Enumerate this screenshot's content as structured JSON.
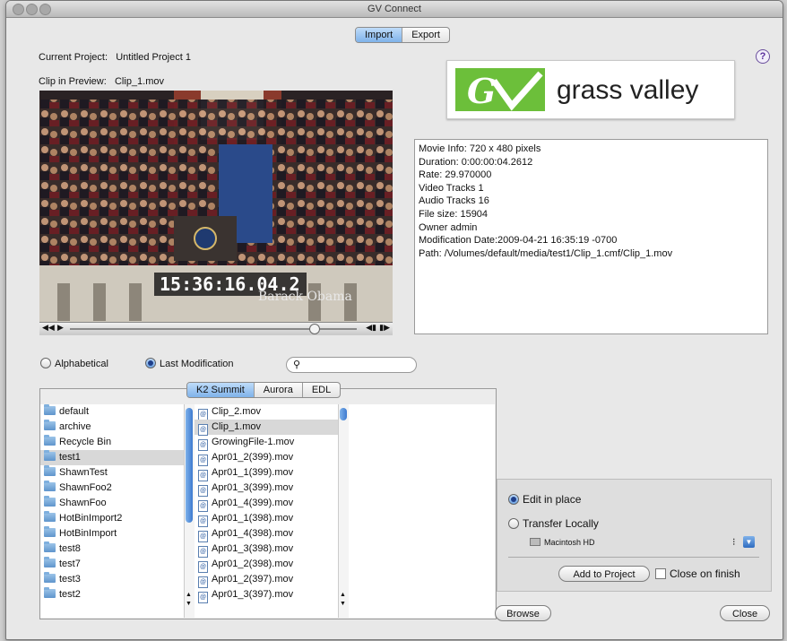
{
  "window": {
    "title": "GV Connect"
  },
  "tabs": {
    "import": "Import",
    "export": "Export",
    "selected": "Import"
  },
  "project": {
    "current_label": "Current Project:",
    "current_value": "Untitled Project 1",
    "preview_label": "Clip in Preview:",
    "preview_value": "Clip_1.mov"
  },
  "help": {
    "label": "?"
  },
  "preview": {
    "timecode": "15:36:16.04.2",
    "caption": "Barack Obama",
    "playhead_fraction": 0.85
  },
  "logo": {
    "text": "grass valley",
    "brand_color": "#6cbf3a"
  },
  "movie_info": {
    "lines": [
      "Movie Info: 720 x 480 pixels",
      "Duration: 0:00:00:04.2612",
      "Rate: 29.970000",
      "Video Tracks 1",
      "Audio Tracks 16",
      "File size: 15904",
      "Owner admin",
      "Modification Date:2009-04-21 16:35:19 -0700",
      "Path: /Volumes/default/media/test1/Clip_1.cmf/Clip_1.mov"
    ]
  },
  "sort": {
    "alphabetical": "Alphabetical",
    "last_modification": "Last Modification",
    "selected": "Last Modification"
  },
  "search": {
    "value": ""
  },
  "source_tabs": {
    "k2": "K2 Summit",
    "aurora": "Aurora",
    "edl": "EDL",
    "selected": "K2 Summit"
  },
  "bins": {
    "items": [
      "default",
      "archive",
      "Recycle Bin",
      "test1",
      "ShawnTest",
      "ShawnFoo2",
      "ShawnFoo",
      "HotBinImport2",
      "HotBinImport",
      "test8",
      "test7",
      "test3",
      "test2"
    ],
    "selected": "test1"
  },
  "clips": {
    "items": [
      "Clip_2.mov",
      "Clip_1.mov",
      "GrowingFile-1.mov",
      "Apr01_2(399).mov",
      "Apr01_1(399).mov",
      "Apr01_3(399).mov",
      "Apr01_4(399).mov",
      "Apr01_1(398).mov",
      "Apr01_4(398).mov",
      "Apr01_3(398).mov",
      "Apr01_2(398).mov",
      "Apr01_2(397).mov",
      "Apr01_3(397).mov"
    ],
    "selected": "Clip_1.mov"
  },
  "options": {
    "edit_in_place": "Edit in place",
    "transfer_locally": "Transfer Locally",
    "selected": "Edit in place",
    "volume": "Macintosh HD",
    "add_button": "Add to Project",
    "close_on_finish": "Close on finish",
    "close_on_finish_checked": false
  },
  "footer": {
    "browse": "Browse",
    "close": "Close"
  }
}
